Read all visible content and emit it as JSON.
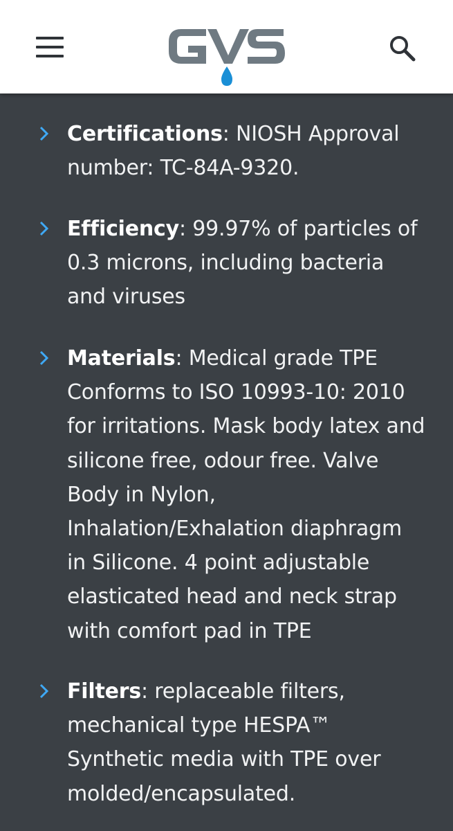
{
  "header": {
    "menu_icon": "hamburger-menu-icon",
    "logo_text": "GVS",
    "search_icon": "search-icon",
    "colors": {
      "logo_gray": "#6f7a82",
      "logo_blue": "#1a8fd6",
      "background": "#ffffff"
    }
  },
  "content": {
    "background": "#3b4045",
    "bullet_color": "#3fa9f5",
    "items": [
      {
        "title": "Certifications",
        "text": ": NIOSH Approval number: TC-84A-9320."
      },
      {
        "title": "Efficiency",
        "text": ": 99.97% of particles of 0.3 microns, including bacteria and viruses"
      },
      {
        "title": "Materials",
        "text": ": Medical grade TPE Conforms to ISO 10993-10: 2010 for irritations. Mask body latex and silicone free, odour free. Valve Body in Nylon, Inhalation/Exhalation diaphragm in Silicone. 4 point adjustable elasticated head and neck strap with comfort pad in TPE"
      },
      {
        "title": "Filters",
        "text": ": replaceable filters, mechanical type HESPA™ Synthetic media with TPE over molded/encapsulated."
      }
    ]
  }
}
